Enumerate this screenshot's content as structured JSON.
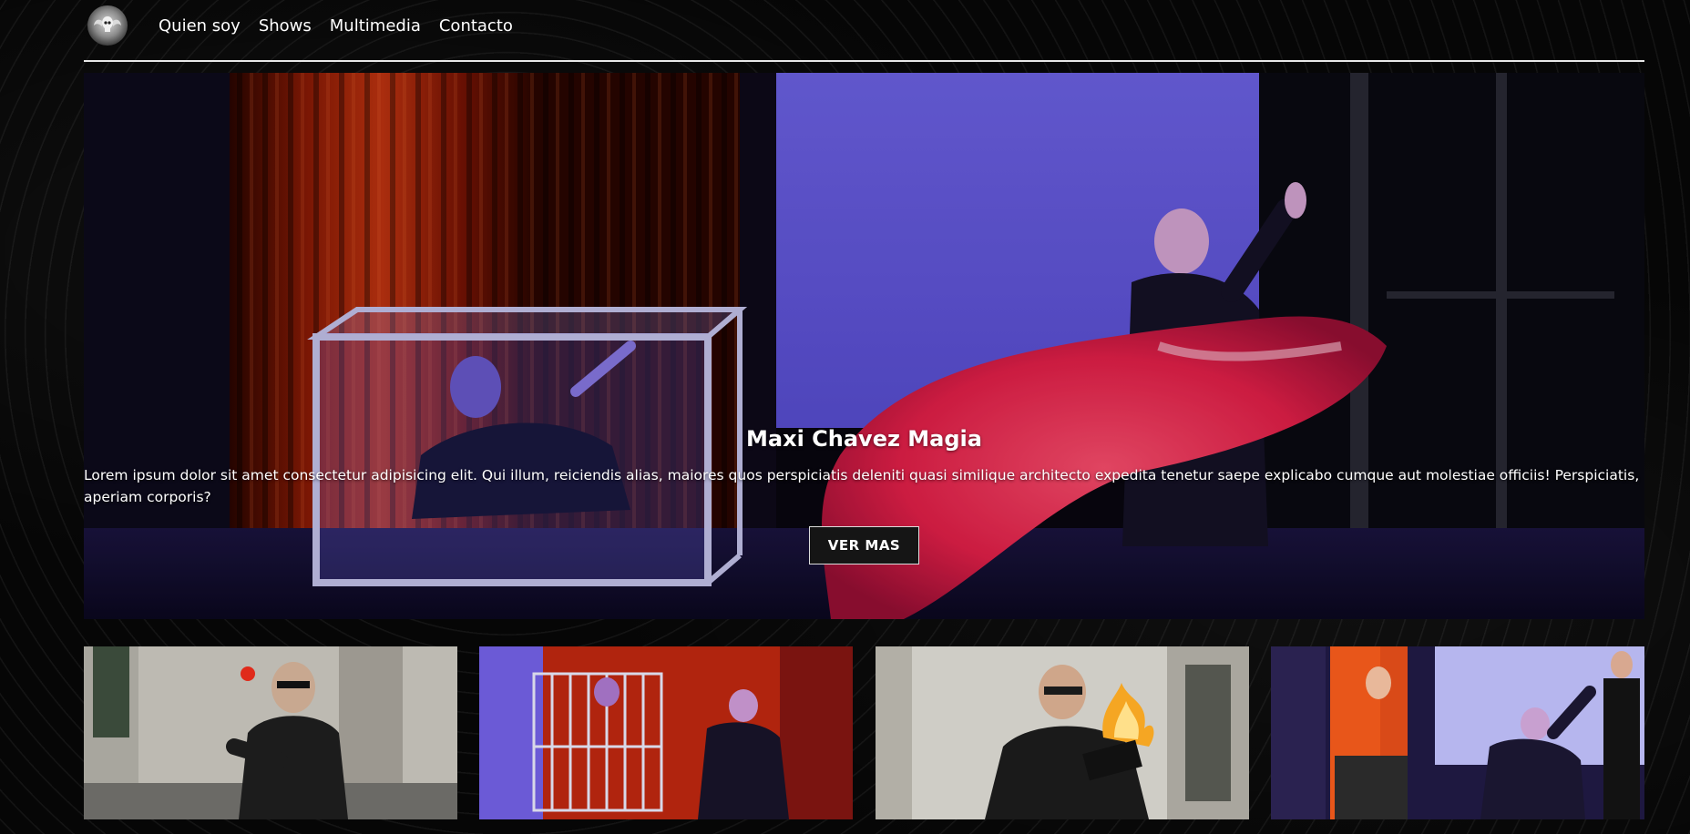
{
  "navbar": {
    "logo_icon": "winged-skull-logo-icon",
    "links": [
      "Quien soy",
      "Shows",
      "Multimedia",
      "Contacto"
    ]
  },
  "hero": {
    "image": "magician-stage-glass-box-red-cloth",
    "title": "Maxi Chavez Magia",
    "text": "Lorem ipsum dolor sit amet consectetur adipisicing elit. Qui illum, reiciendis alias, maiores quos perspiciatis deleniti quasi similique architecto expedita tenetur saepe explicabo cumque aut molestiae officiis! Perspiciatis, aperiam corporis?",
    "button_label": "VER MAS"
  },
  "gallery": {
    "thumbnails": [
      {
        "image": "magician-juggling-red-ball"
      },
      {
        "image": "assistant-in-cage-with-magician"
      },
      {
        "image": "magician-with-burning-book"
      },
      {
        "image": "magician-with-illusion-cabinet"
      }
    ]
  },
  "colors": {
    "background": "#060606",
    "text": "#ffffff",
    "divider": "#e8e8e8",
    "button_bg": "#151515"
  }
}
